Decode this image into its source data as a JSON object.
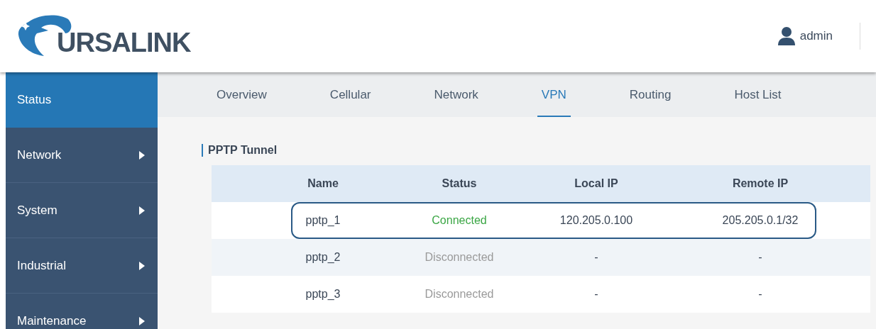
{
  "header": {
    "logo_text": "URSALINK",
    "user": "admin"
  },
  "sidebar": {
    "items": [
      {
        "label": "Status",
        "selected": true,
        "has_submenu": false
      },
      {
        "label": "Network",
        "selected": false,
        "has_submenu": true
      },
      {
        "label": "System",
        "selected": false,
        "has_submenu": true
      },
      {
        "label": "Industrial",
        "selected": false,
        "has_submenu": true
      },
      {
        "label": "Maintenance",
        "selected": false,
        "has_submenu": true
      }
    ]
  },
  "tabs": [
    {
      "label": "Overview",
      "selected": false
    },
    {
      "label": "Cellular",
      "selected": false
    },
    {
      "label": "Network",
      "selected": false
    },
    {
      "label": "VPN",
      "selected": true
    },
    {
      "label": "Routing",
      "selected": false
    },
    {
      "label": "Host List",
      "selected": false
    }
  ],
  "section": {
    "title": "PPTP Tunnel"
  },
  "table": {
    "columns": [
      "Name",
      "Status",
      "Local IP",
      "Remote IP"
    ],
    "rows": [
      {
        "cells": [
          "pptp_1",
          "Connected",
          "120.205.0.100",
          "205.205.0.1/32"
        ],
        "connected": true,
        "highlighted": true
      },
      {
        "cells": [
          "pptp_2",
          "Disconnected",
          "-",
          "-"
        ],
        "connected": false,
        "highlighted": false
      },
      {
        "cells": [
          "pptp_3",
          "Disconnected",
          "-",
          "-"
        ],
        "connected": false,
        "highlighted": false
      }
    ]
  }
}
